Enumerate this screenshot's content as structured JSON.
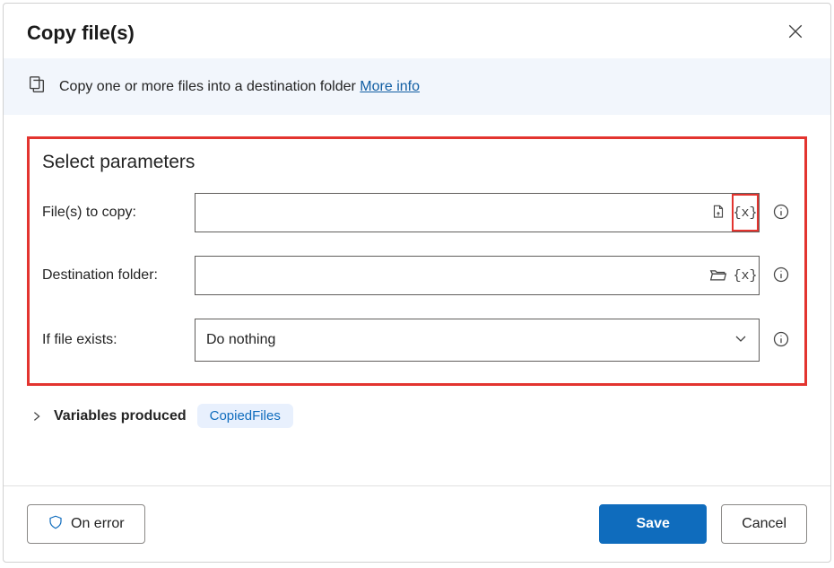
{
  "header": {
    "title": "Copy file(s)"
  },
  "banner": {
    "text": "Copy one or more files into a destination folder ",
    "link": "More info"
  },
  "section": {
    "title": "Select parameters",
    "field_files_label": "File(s) to copy:",
    "field_dest_label": "Destination folder:",
    "field_exists_label": "If file exists:",
    "exists_value": "Do nothing"
  },
  "variables": {
    "label": "Variables produced",
    "chip": "CopiedFiles"
  },
  "footer": {
    "on_error": "On error",
    "save": "Save",
    "cancel": "Cancel"
  },
  "glyphs": {
    "var": "{x}"
  }
}
